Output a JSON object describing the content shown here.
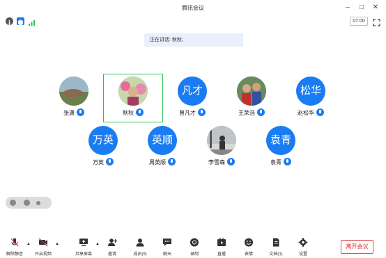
{
  "window": {
    "title": "腾讯会议"
  },
  "info": {
    "timer": "07:00"
  },
  "speaking": {
    "text": "正在讲话: 秋秋;"
  },
  "participants": [
    {
      "name": "张潇",
      "avatar": "photo"
    },
    {
      "name": "秋秋",
      "avatar": "photo"
    },
    {
      "name": "曾凡才",
      "avatar": "凡才"
    },
    {
      "name": "王荣浩",
      "avatar": "photo"
    },
    {
      "name": "赵松华",
      "avatar": "松华"
    },
    {
      "name": "万英",
      "avatar": "万英"
    },
    {
      "name": "周英顺",
      "avatar": "英顺"
    },
    {
      "name": "李雪森",
      "avatar": "photo"
    },
    {
      "name": "袁青",
      "avatar": "袁青"
    }
  ],
  "toolbar": {
    "unmute": "解除静音",
    "video": "开启视频",
    "share": "共享屏幕",
    "invite": "邀请",
    "members": "成员(9)",
    "chat": "聊天",
    "record": "录制",
    "live": "直播",
    "reactions": "表情",
    "docs": "文档(1)",
    "settings": "设置",
    "leave": "离开会议"
  },
  "colors": {
    "accent": "#1a7cf2",
    "active_border": "#2ec25b",
    "leave": "#e03030"
  }
}
